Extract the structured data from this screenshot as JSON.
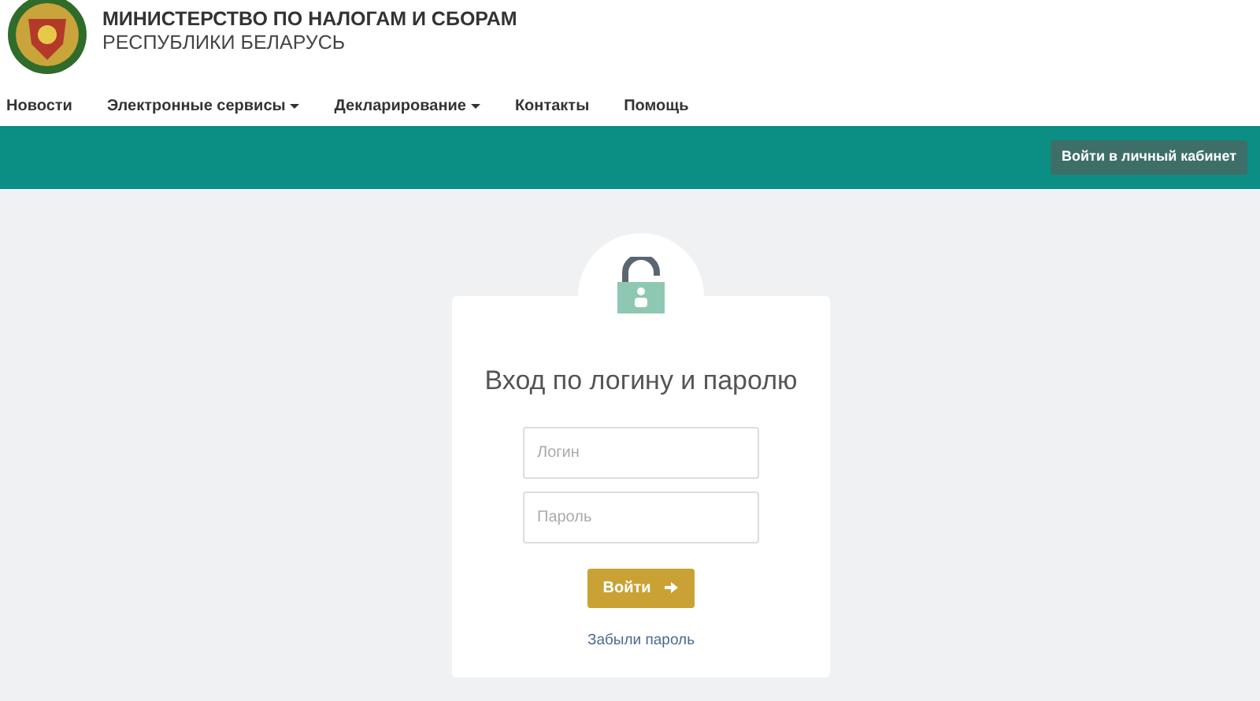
{
  "header": {
    "title": "МИНИСТЕРСТВО ПО НАЛОГАМ И СБОРАМ",
    "subtitle": "РЕСПУБЛИКИ БЕЛАРУСЬ"
  },
  "nav": [
    {
      "label": "Новости",
      "dropdown": false
    },
    {
      "label": "Электронные сервисы",
      "dropdown": true
    },
    {
      "label": "Декларирование",
      "dropdown": true
    },
    {
      "label": "Контакты",
      "dropdown": false
    },
    {
      "label": "Помощь",
      "dropdown": false
    }
  ],
  "banner": {
    "button": "Войти в личный кабинет"
  },
  "login": {
    "title": "Вход по логину и паролю",
    "fields": [
      {
        "placeholder": "Логин"
      },
      {
        "placeholder": "Пароль"
      }
    ],
    "submit": "Войти",
    "forgot": "Забыли пароль"
  }
}
